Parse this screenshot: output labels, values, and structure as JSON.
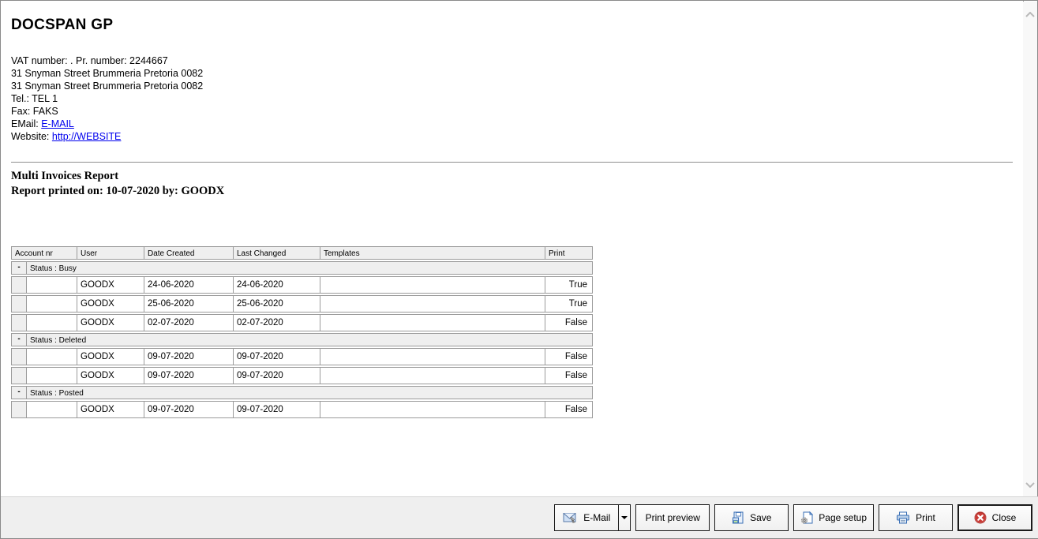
{
  "company": {
    "name": "DOCSPAN GP",
    "vat_line": "VAT number: . Pr. number: 2244667",
    "address_line1": "31 Snyman Street Brummeria Pretoria 0082",
    "address_line2": "31 Snyman Street Brummeria Pretoria 0082",
    "tel_line": "Tel.: TEL 1",
    "fax_line": "Fax: FAKS",
    "email_label": "EMail: ",
    "email_link": "E-MAIL",
    "website_label": "Website: ",
    "website_link": "http://WEBSITE"
  },
  "report": {
    "title": "Multi Invoices Report",
    "printed_line": "Report printed on: 10-07-2020 by: GOODX"
  },
  "table": {
    "columns": [
      "Account nr",
      "User",
      "Date Created",
      "Last Changed",
      "Templates",
      "Print"
    ],
    "groups": [
      {
        "glyph": "-",
        "label": "Status : Busy",
        "rows": [
          {
            "account": "",
            "user": "GOODX",
            "date_created": "24-06-2020",
            "last_changed": "24-06-2020",
            "templates": "",
            "print": "True"
          },
          {
            "account": "",
            "user": "GOODX",
            "date_created": "25-06-2020",
            "last_changed": "25-06-2020",
            "templates": "",
            "print": "True"
          },
          {
            "account": "",
            "user": "GOODX",
            "date_created": "02-07-2020",
            "last_changed": "02-07-2020",
            "templates": "",
            "print": "False"
          }
        ]
      },
      {
        "glyph": "-",
        "label": "Status : Deleted",
        "rows": [
          {
            "account": "",
            "user": "GOODX",
            "date_created": "09-07-2020",
            "last_changed": "09-07-2020",
            "templates": "",
            "print": "False"
          },
          {
            "account": "",
            "user": "GOODX",
            "date_created": "09-07-2020",
            "last_changed": "09-07-2020",
            "templates": "",
            "print": "False"
          }
        ]
      },
      {
        "glyph": "-",
        "label": "Status : Posted",
        "rows": [
          {
            "account": "",
            "user": "GOODX",
            "date_created": "09-07-2020",
            "last_changed": "09-07-2020",
            "templates": "",
            "print": "False"
          }
        ]
      }
    ]
  },
  "toolbar": {
    "email_label": "E-Mail",
    "print_preview_label": "Print preview",
    "save_label": "Save",
    "page_setup_label": "Page setup",
    "print_label": "Print",
    "close_label": "Close"
  },
  "icons": {
    "email": "envelope-with-pen-icon",
    "save": "floppy-disk-icon",
    "page_setup": "page-with-gear-icon",
    "print": "printer-icon",
    "close": "red-circle-x-icon",
    "scroll_up": "chevron-up-icon",
    "scroll_down": "chevron-down-icon",
    "email_dropdown": "dropdown-arrow-icon"
  },
  "colors": {
    "link_blue": "#0000EE",
    "close_red": "#c93a35",
    "table_border": "#9b9b9b",
    "group_row_bg": "#efefef",
    "toolbar_bg": "#efefef",
    "button_border": "#1a1a1a",
    "scroll_track": "#f8f8f8",
    "icon_blue": "#3a6fb5"
  }
}
